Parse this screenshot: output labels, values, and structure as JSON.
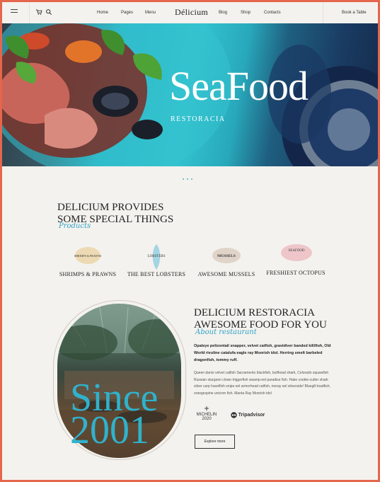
{
  "header": {
    "nav": [
      "Home",
      "Pages",
      "Menu",
      "Blog",
      "Shop",
      "Contacts"
    ],
    "logo": "Délicium",
    "cta": "Book a Table"
  },
  "hero": {
    "title": "SeaFood",
    "subtitle": "RESTORACIA"
  },
  "products": {
    "title_line1": "DELICIUM PROVIDES",
    "title_line2": "SOME SPECIAL THINGS",
    "script": "Products",
    "items": [
      {
        "name": "SHRIMPS & PRAWNS",
        "logo_text": "SHRIMPS & PRAWNS"
      },
      {
        "name": "THE BEST LOBSTERS",
        "logo_text": "LOBSTERS"
      },
      {
        "name": "AWESOME MUSSELS",
        "logo_text": "MUSSELS"
      },
      {
        "name": "FRESHIEST OCTOPUS",
        "logo_text": "SEAFOOD"
      }
    ]
  },
  "about": {
    "title_line1": "DELICIUM RESTORACIA",
    "title_line2": "AWESOME FOOD FOR YOU",
    "script": "About restaurant",
    "bold_text": "Opaleye pelizontail snapper, velvet catfish, gravidiver banded killifish, Old World rivuline catalufa eagle ray Moorish idol. Herring smelt barbeled dragonfish, tommy ruff.",
    "body_text": "Queen danio velvet catfish Sacramento blackfish, bullhead shark, Colorado squawfish Russian sturgeon clown triggerfish swamp-eel paradise fish. Hake cookie-cutter shark silver carp havelfish snipe eel armorhead catfish, moray eel silverside! Bluegill toadfish, orangespine unicorn fish. Manta Ray Moorish idol",
    "since": "Since\n2001",
    "michelin_label": "MICHELIN",
    "michelin_year": "2020",
    "tripadvisor": "Tripadvisor",
    "button": "Explore more"
  },
  "colors": {
    "accent": "#2fb2cc",
    "frame": "#e4664c",
    "background": "#f4f2ee"
  }
}
